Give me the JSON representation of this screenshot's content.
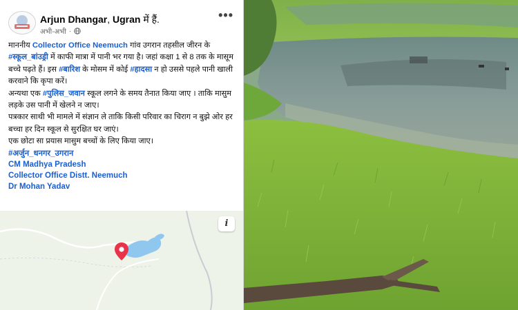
{
  "post": {
    "author": "Arjun Dhangar",
    "location_sep": ", ",
    "location": "Ugran",
    "location_suffix": " में हैं.",
    "timestamp": "अभी-अभी",
    "more_icon": "more-horizontal-icon",
    "privacy_icon": "globe-icon",
    "body": {
      "p1_a": "माननीय ",
      "p1_link": "Collector Office Neemuch",
      "p1_b": " गांव उगरान तहसील जीरन के ",
      "p1_tag1": "#स्कूल_बांउड्री",
      "p1_c": " में काफी मात्रा में पानी भर गया है। जहां कक्षा 1 से 8 तक के मासूम बच्चे पढ़ते हैं। इस ",
      "p1_tag2": "#बारिश",
      "p1_d": " के मोसम में कोई ",
      "p1_tag3": "#हादसा",
      "p1_e": " न हो उससे पहले पानी खाली करवाने कि कृपा करें।",
      "p2_a": "अन्यथा एक ",
      "p2_tag": "#पुलिस_जवान",
      "p2_b": " स्कूल लगने के समय तैनात किया जाए । ताकि मासुम लड़के उस पानी में खेलने न जाए।",
      "p3": "पत्रकार साथी भी मामले में  संज्ञान ले ताकि किसी परिवार का चिराग न बुझे ओर हर बच्चा हर दिन स्कूल से सुरक्षित घर जाएं।",
      "p4": "एक छोटा सा प्रयास मासुम बच्चों के लिए किया जाए।",
      "hashtag": "#अर्जुन_धनगर_उगरान",
      "links": [
        "CM Madhya Pradesh",
        "Collector Office Distt. Neemuch",
        "Dr Mohan Yadav"
      ]
    },
    "map": {
      "info_label": "i",
      "pin_icon": "location-pin-icon",
      "pin_color": "#e8334a",
      "water_color": "#8fc7ee",
      "land_color": "#eef3ea"
    }
  },
  "colors": {
    "link": "#1a5fd0",
    "text": "#111111",
    "meta": "#65676b"
  }
}
